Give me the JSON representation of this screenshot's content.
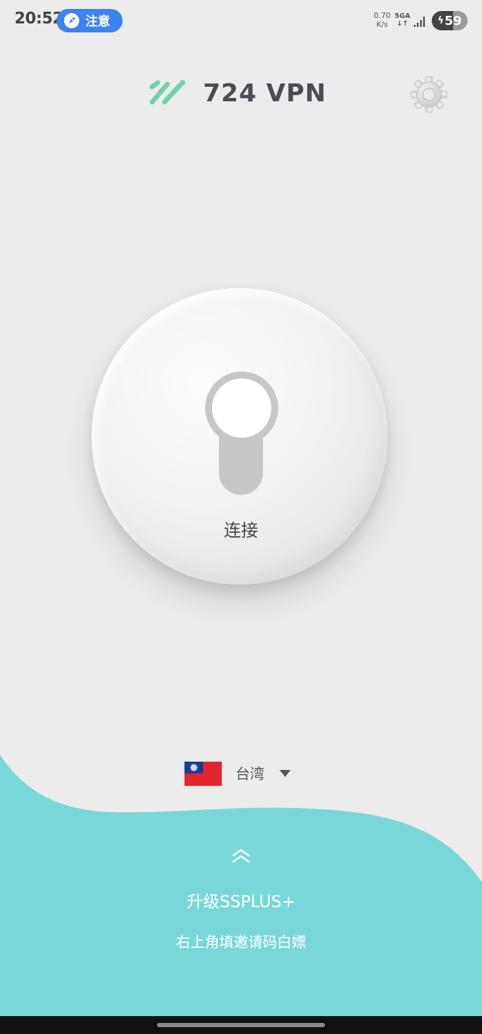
{
  "status_bar": {
    "time": "20:52",
    "notice_label": "注意",
    "net_speed_value": "0.70",
    "net_speed_unit": "K/s",
    "network_type": "5GA",
    "battery_level": "59",
    "battery_fraction": 0.59
  },
  "header": {
    "app_name": "724 VPN",
    "settings_icon": "gear-icon"
  },
  "connect": {
    "label": "连接",
    "state": "off"
  },
  "country": {
    "name": "台湾",
    "flag_icon": "taiwan-flag-icon"
  },
  "upgrade": {
    "title": "升级SSPLUS+",
    "subtitle": "右上角填邀请码白嫖"
  },
  "colors": {
    "background": "#ececec",
    "accent_teal": "#79d8d7",
    "logo_green": "#6fd2a6",
    "notice_blue": "#3c82f0"
  }
}
